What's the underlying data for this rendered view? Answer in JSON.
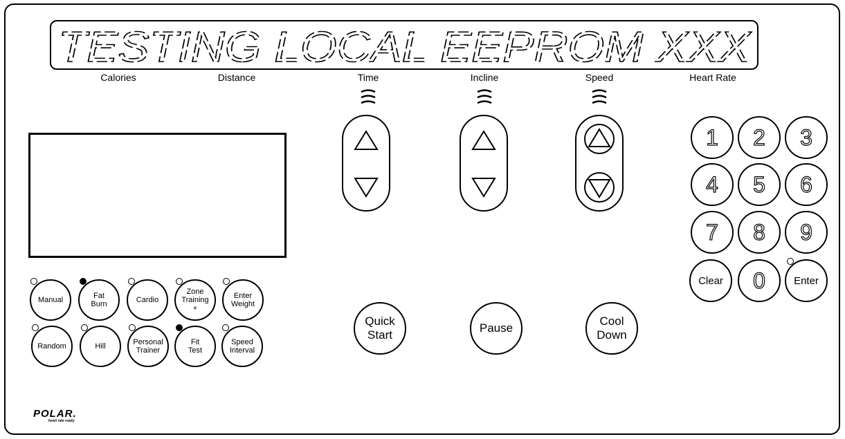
{
  "display": {
    "message": "TESTING LOCAL EEPROM XXX",
    "labels": [
      "Calories",
      "Distance",
      "Time",
      "Incline",
      "Speed",
      "Heart Rate"
    ]
  },
  "adjust_controls": [
    {
      "name": "time",
      "up_icon": "up-triangle",
      "down_icon": "down-triangle"
    },
    {
      "name": "incline",
      "up_icon": "up-triangle",
      "down_icon": "down-triangle"
    },
    {
      "name": "speed",
      "up_icon": "up-triangle-circled",
      "down_icon": "down-triangle-circled"
    }
  ],
  "programs": [
    {
      "label": "Manual",
      "led_on": false
    },
    {
      "label": "Fat\nBurn",
      "led_on": true
    },
    {
      "label": "Cardio",
      "led_on": false
    },
    {
      "label": "Zone\nTraining\n+",
      "led_on": false
    },
    {
      "label": "Enter\nWeight",
      "led_on": false
    },
    {
      "label": "Random",
      "led_on": false
    },
    {
      "label": "Hill",
      "led_on": false
    },
    {
      "label": "Personal\nTrainer",
      "led_on": false
    },
    {
      "label": "Fit\nTest",
      "led_on": true
    },
    {
      "label": "Speed\nInterval",
      "led_on": false
    }
  ],
  "actions": {
    "quick_start": "Quick\nStart",
    "pause": "Pause",
    "cool_down": "Cool\nDown"
  },
  "keypad": [
    "1",
    "2",
    "3",
    "4",
    "5",
    "6",
    "7",
    "8",
    "9",
    "Clear",
    "0",
    "Enter"
  ],
  "keypad_enter_led_on": false,
  "brand": {
    "logo": "POLAR.",
    "tagline": "heart rate ready"
  },
  "colors": {
    "ink": "#000000",
    "background": "#ffffff"
  }
}
